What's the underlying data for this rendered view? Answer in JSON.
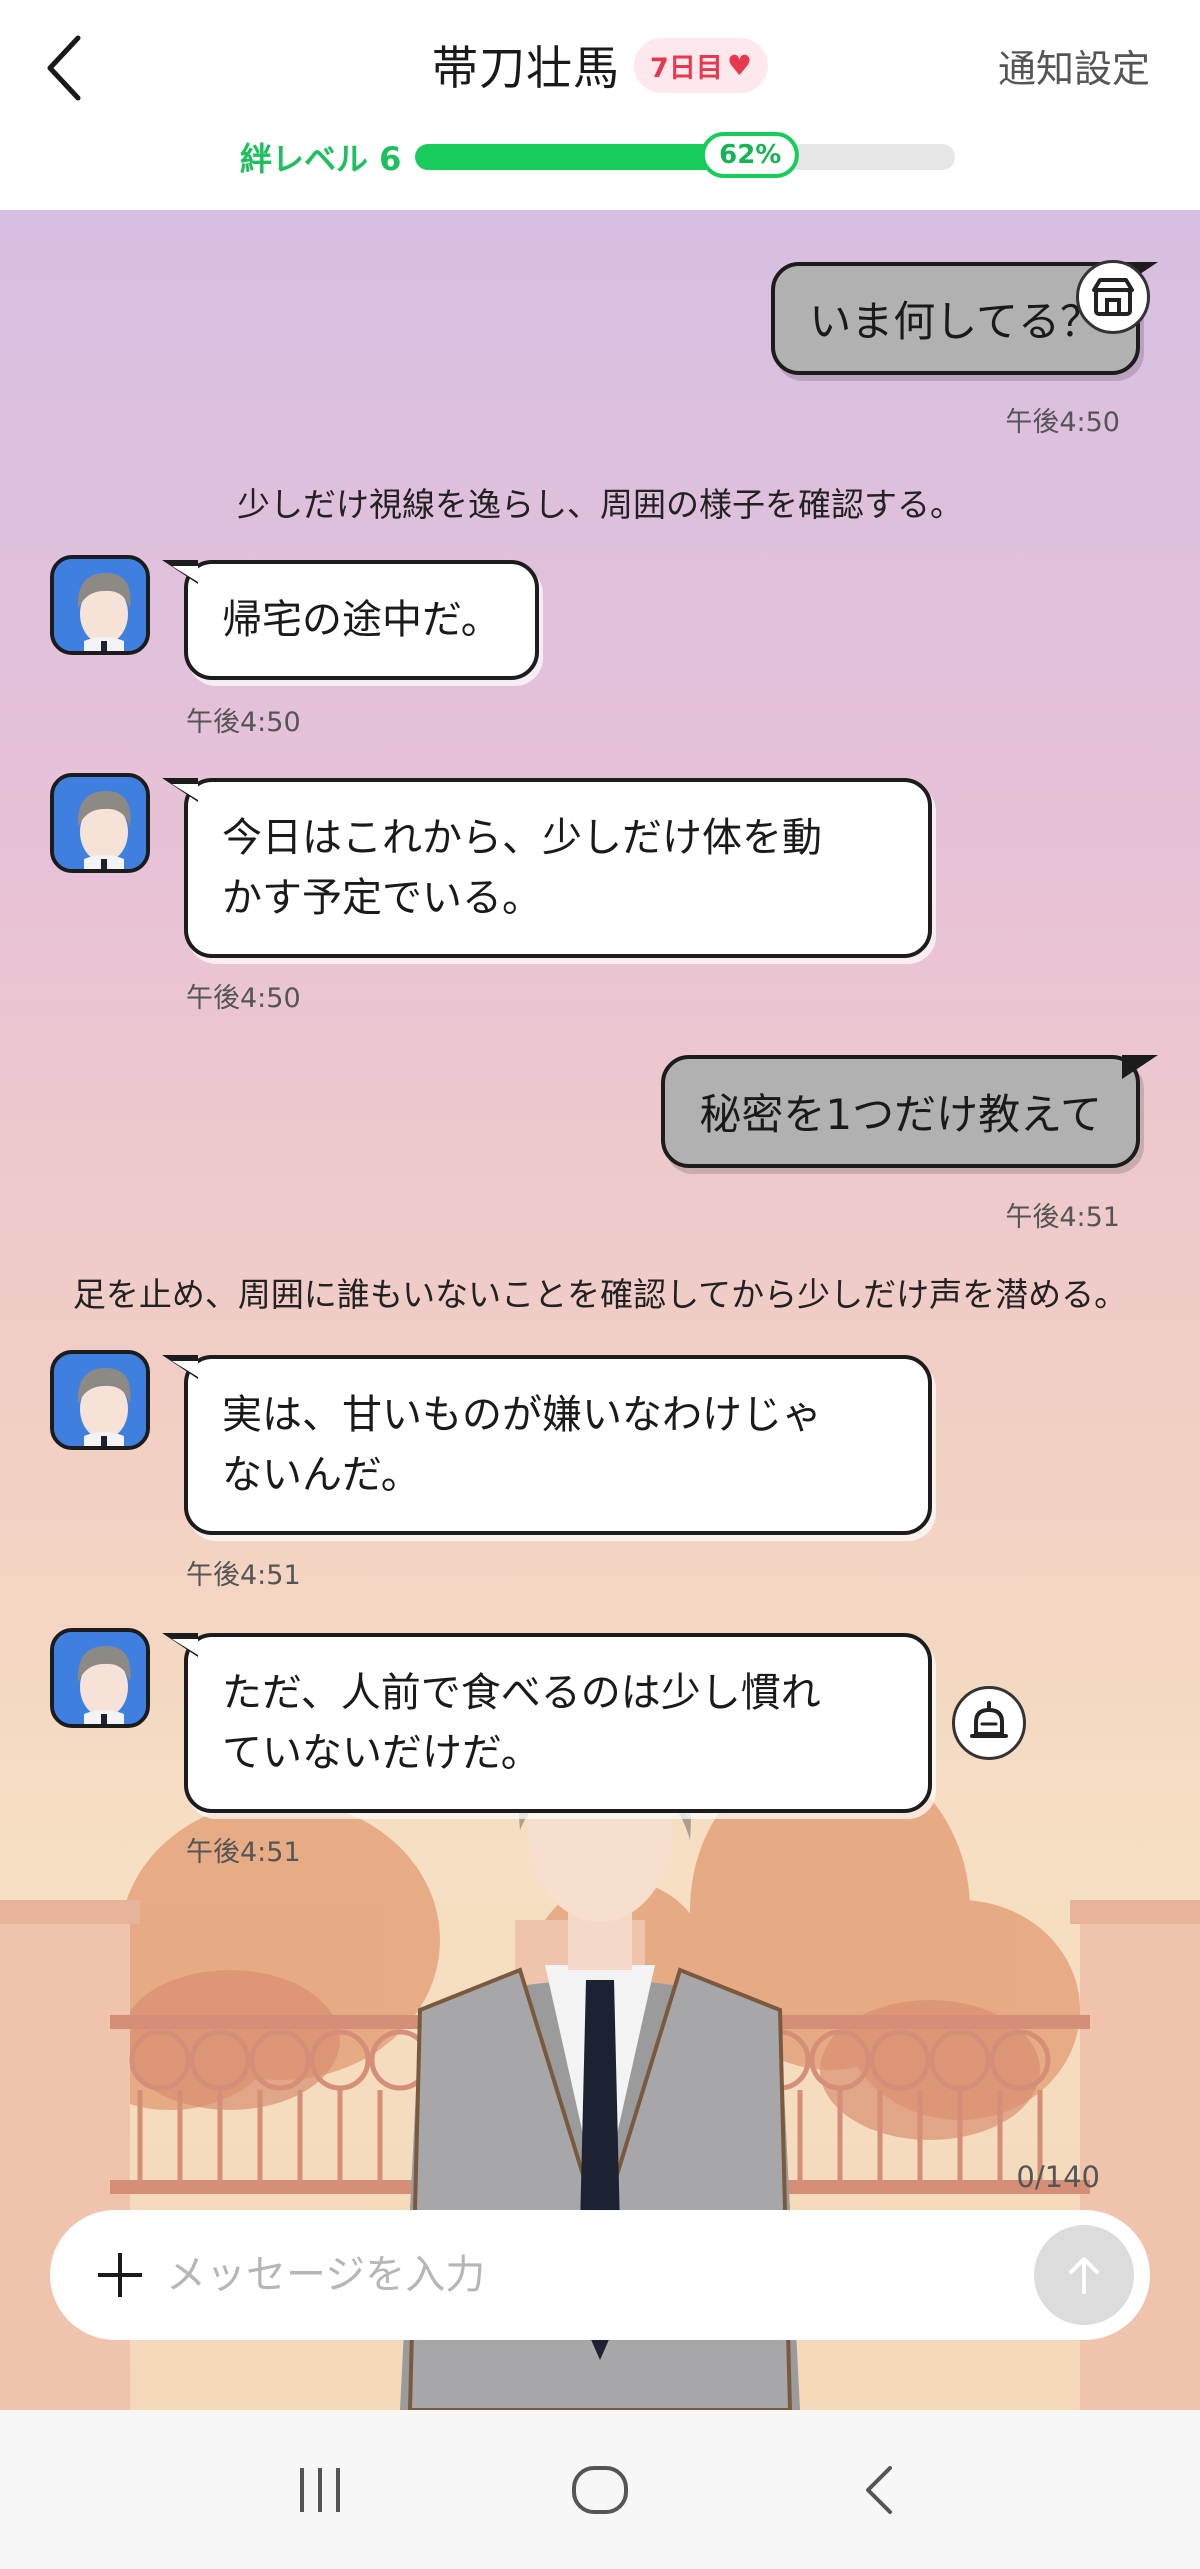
{
  "header": {
    "title": "帯刀壮馬",
    "day_badge": "7日目",
    "notify_label": "通知設定",
    "bond_label": "絆レベル 6",
    "bond_percent_label": "62%",
    "bond_progress": 0.62
  },
  "messages": [
    {
      "type": "user",
      "text": "いま何してる？",
      "time": "午後4:50"
    },
    {
      "type": "narration",
      "text": "少しだけ視線を逸らし、周囲の様子を確認する。"
    },
    {
      "type": "bot",
      "text": "帰宅の途中だ。",
      "time": "午後4:50"
    },
    {
      "type": "bot",
      "text_lines": [
        "今日はこれから、少しだけ体を動",
        "かす予定でいる。"
      ],
      "time": "午後4:50"
    },
    {
      "type": "user",
      "text": "秘密を1つだけ教えて",
      "time": "午後4:51"
    },
    {
      "type": "narration",
      "text": "足を止め、周囲に誰もいないことを確認してから少しだけ声を潜める。"
    },
    {
      "type": "bot",
      "text_lines": [
        "実は、甘いものが嫌いなわけじゃ",
        "ないんだ。"
      ],
      "time": "午後4:51"
    },
    {
      "type": "bot",
      "text_lines": [
        "ただ、人前で食べるのは少し慣れ",
        "ていないだけだ。"
      ],
      "time": "午後4:51"
    }
  ],
  "composer": {
    "char_count": "0/140",
    "placeholder": "メッセージを入力"
  },
  "colors": {
    "bond_green": "#17cc5a",
    "badge_red": "#e63950",
    "user_bubble": "#b1b1b1",
    "bot_bubble": "#ffffff"
  }
}
